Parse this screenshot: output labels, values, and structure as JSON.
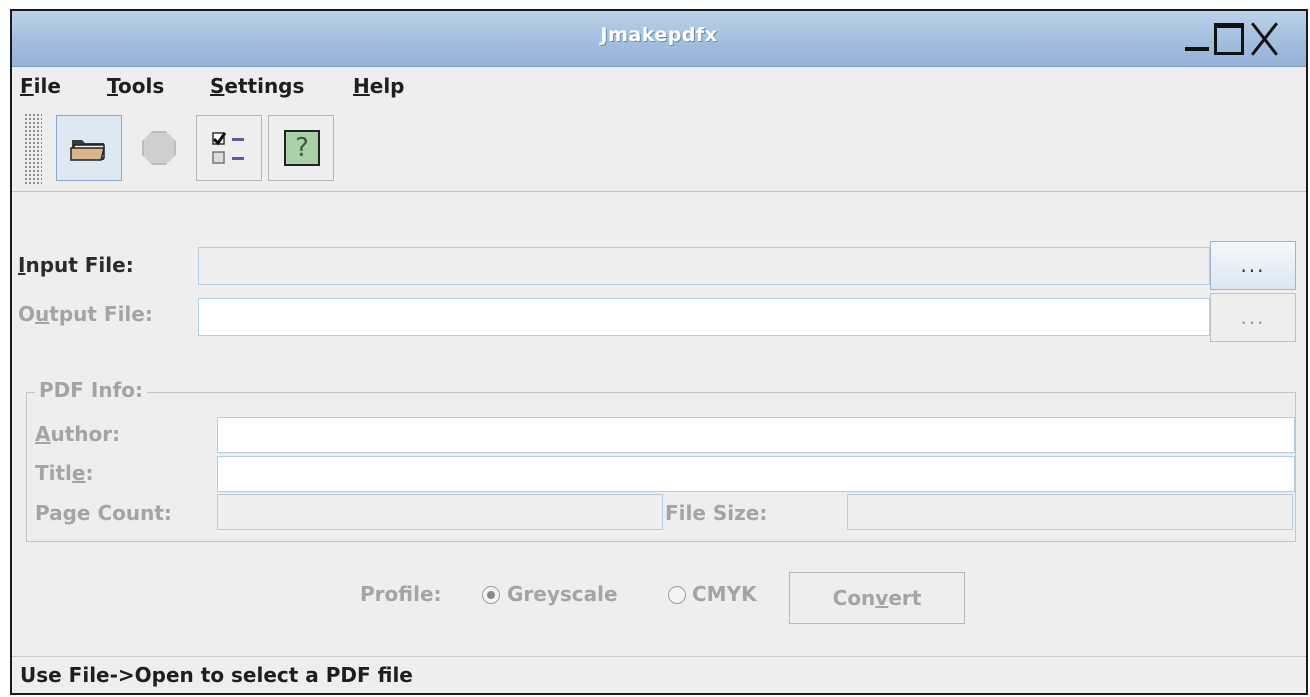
{
  "window": {
    "title": "Jmakepdfx"
  },
  "menus": [
    {
      "mnemonic": "F",
      "rest": "ile"
    },
    {
      "mnemonic": "T",
      "rest": "ools"
    },
    {
      "mnemonic": "S",
      "rest": "ettings"
    },
    {
      "mnemonic": "H",
      "rest": "elp"
    }
  ],
  "toolbar": {
    "open_icon": "folder-open-icon",
    "stop_icon": "stop-icon",
    "options_icon": "checklist-icon",
    "help_icon": "help-question-icon",
    "help_glyph": "?"
  },
  "form": {
    "input_file": {
      "label_pre": "",
      "label_mn": "I",
      "label_post": "nput File:",
      "value": "",
      "browse_label": "..."
    },
    "output_file": {
      "label_pre": "O",
      "label_mn": "u",
      "label_post": "tput File:",
      "value": "",
      "browse_label": "..."
    },
    "pdf_info": {
      "group_title": "PDF Info:",
      "author": {
        "label_pre": "",
        "label_mn": "A",
        "label_post": "uthor:",
        "value": ""
      },
      "title": {
        "label_pre": "Titl",
        "label_mn": "e",
        "label_post": ":",
        "value": ""
      },
      "page_count": {
        "label": "Page Count:",
        "value": ""
      },
      "file_size": {
        "label": "File Size:",
        "value": ""
      }
    },
    "profile": {
      "label": "Profile:",
      "options": [
        {
          "pre": "",
          "mn": "G",
          "post": "reyscale",
          "selected": true
        },
        {
          "pre": "CMY",
          "mn": "K",
          "post": "",
          "selected": false
        }
      ]
    },
    "convert": {
      "pre": "Con",
      "mn": "v",
      "post": "ert"
    }
  },
  "status": "Use File->Open to select a PDF file",
  "colors": {
    "titlebar": "#a3bede",
    "disabled_text": "#a4a4a4",
    "field_border": "#b7cbe0"
  }
}
